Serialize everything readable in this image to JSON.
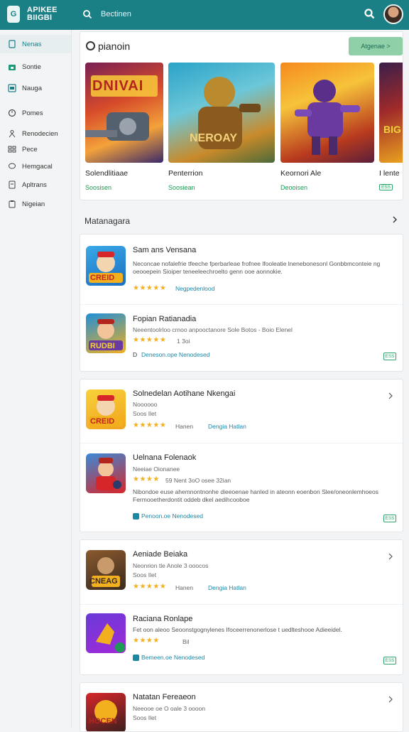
{
  "header": {
    "brand_line1": "APIKEE",
    "brand_line2": "BIIGBI",
    "logo_glyph": "G",
    "search_label": "Bectinen",
    "search_icon": "search-icon",
    "search_button_icon": "search-icon",
    "avatar": "user-avatar",
    "bg_color": "#1b7f86"
  },
  "sidebar": {
    "items": [
      {
        "label": "Nenas",
        "icon": "page-icon",
        "active": true
      },
      {
        "label": "Sontie",
        "icon": "store-icon"
      },
      {
        "label": "Nauga",
        "icon": "image-icon"
      },
      {
        "label": "Pomes",
        "icon": "clock-icon"
      },
      {
        "label": "Renodecien",
        "icon": "person-icon"
      },
      {
        "label": "Pece",
        "icon": "grid-icon"
      },
      {
        "label": "Hemgacal",
        "icon": "chat-icon"
      },
      {
        "label": "Apltrans",
        "icon": "file-icon"
      },
      {
        "label": "Nigeian",
        "icon": "clipboard-icon"
      }
    ]
  },
  "featured": {
    "title": "pianoin",
    "button_label": "Atgenae >",
    "cards": [
      {
        "name": "Solendlitiaae",
        "price": "Soosisen",
        "art_text": "DNIVAI"
      },
      {
        "name": "Penterrion",
        "price": "Soosiean",
        "art_text": "NEROAY"
      },
      {
        "name": "Keornori Ale",
        "price": "Deooisen",
        "art_text": ""
      },
      {
        "name": "I lente",
        "price": "ESS",
        "art_text": "BIG"
      }
    ]
  },
  "section": {
    "title": "Matanagara",
    "arrow": "chevron-right-icon"
  },
  "panels": [
    {
      "rows": [
        {
          "title": "Sam ans Vensana",
          "desc": "Neconcae nofalefrie tfeeche fperbarleae frofnee lfooleatie lnenebonesonl Gonbbmconteie ng oeooepein Sioiper teneeleechroelto genn ooe aonnokie.",
          "stars": "★★★★★",
          "link": "Negpedenlood",
          "icon_text": "CREID"
        },
        {
          "title": "Fopian Ratianadia",
          "sub": "Neeentoolrloo crnoo anpooctanore Sole Botos - Boio Elenel",
          "stars": "★★★★★",
          "rating": "1 3oi",
          "link": "Deneson.ope Nenodesed",
          "link_prefix": "D",
          "badge": "ESS",
          "icon_text": "RUDBI"
        }
      ]
    },
    {
      "rows": [
        {
          "title": "Solnedelan Aotihane Nkengai",
          "sub": "Noooooo",
          "sub2": "Soos Ilet",
          "stars": "★★★★★",
          "rating": "Hanen",
          "link": "Dengia Hatlan",
          "icon_text": "CREID"
        },
        {
          "title": "Uelnana Folenaok",
          "sub": "Neeiae Oionanee",
          "stars": "★★★★",
          "rating": "59  Nent 3oO osee 32ian",
          "desc": "Nibondoe euse ahemnontnonhe dieeoenae hanled in ateonn eoenbon Slee/oneonlemhoeos Fermooetherdontit oddeb dkel aedihcooboe",
          "link": "Penoon.oe Nenodesed",
          "badge": "ESS",
          "icon_text": ""
        }
      ]
    },
    {
      "rows": [
        {
          "title": "Aeniade Beiaka",
          "sub": "Neonrion tle Anole 3 ooocos",
          "sub2": "Soos Ilet",
          "stars": "★★★★★",
          "rating": "Hanen",
          "link": "Dengia Hatlan",
          "icon_text": "CNEAG"
        },
        {
          "title": "Raciana Ronlape",
          "desc": "Fet oon aleoo Seoonstgognylenes Ifoceerrenonerlose t uedlteshooe Adieeidel.",
          "stars": "★★★★",
          "rating": "Bil",
          "link": "Bemeen.oe Nenodesed",
          "badge": "ESS",
          "icon_text": ""
        }
      ]
    },
    {
      "rows": [
        {
          "title": "Natatan Fereaeon",
          "sub": "Neeooe oe  O oale 3 oooon",
          "sub2": "Soos Ilet",
          "icon_text": "HOCEN"
        }
      ]
    }
  ],
  "colors": {
    "accent": "#1b7f86",
    "price_green": "#1d9a55",
    "link_blue": "#1b88a6",
    "star": "#f2b01e",
    "button_green": "#8fd0a8"
  }
}
